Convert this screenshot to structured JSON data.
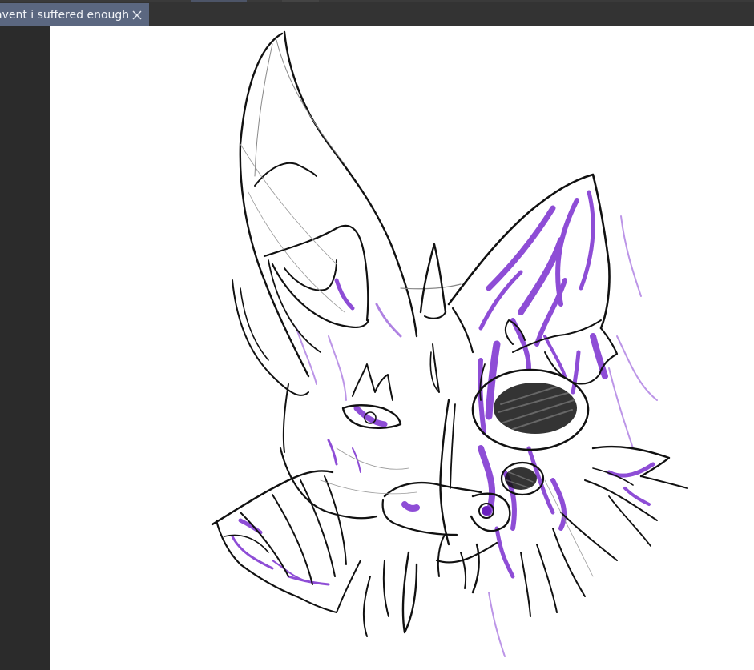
{
  "document_tab": {
    "title": "avent i suffered enough",
    "close_icon": "close-icon"
  },
  "colors": {
    "ui_background": "#2b2b2b",
    "tab_active": "#5b6780",
    "canvas": "#ffffff",
    "ink": "#111111",
    "accent_purple": "#7b2fd0"
  },
  "canvas": {
    "artwork": "bat-creature-sketch"
  }
}
